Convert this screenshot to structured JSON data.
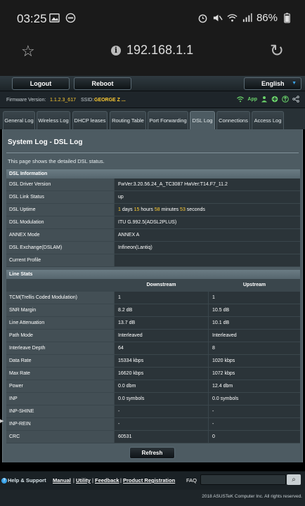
{
  "status_bar": {
    "time": "03:25",
    "battery": "86%"
  },
  "browser": {
    "url": "192.168.1.1"
  },
  "header": {
    "logout_label": "Logout",
    "reboot_label": "Reboot",
    "language": "English",
    "firmware_label": "Firmware Version:",
    "firmware_value": "1.1.2.3_617",
    "ssid_label": "SSID:",
    "ssid_value": "GEORGE Z ...",
    "app_label": "App"
  },
  "tabs": [
    {
      "label": "General Log"
    },
    {
      "label": "Wireless Log"
    },
    {
      "label": "DHCP leases"
    },
    {
      "label": "Routing Table"
    },
    {
      "label": "Port Forwarding"
    },
    {
      "label": "DSL Log"
    },
    {
      "label": "Connections"
    },
    {
      "label": "Access Log"
    }
  ],
  "page": {
    "title": "System Log - DSL Log",
    "description": "This page shows the detailed DSL status."
  },
  "dsl_info": {
    "heading": "DSL Information",
    "rows": [
      {
        "label": "DSL Driver Version",
        "value": "FwVer:3.20.56.24_A_TC3087 HwVer:T14.F7_11.2"
      },
      {
        "label": "DSL Link Status",
        "value": "up"
      },
      {
        "label": "DSL Uptime",
        "days": "1",
        "days_unit": "days",
        "hours": "15",
        "hours_unit": "hours",
        "minutes": "58",
        "minutes_unit": "minutes",
        "seconds": "53",
        "seconds_unit": "seconds"
      },
      {
        "label": "DSL Modulation",
        "value": "ITU G.992.5(ADSL2PLUS)"
      },
      {
        "label": "ANNEX Mode",
        "value": "ANNEX A"
      },
      {
        "label": "DSL Exchange(DSLAM)",
        "value": "Infineon(Lantiq)"
      },
      {
        "label": "Current Profile",
        "value": ""
      }
    ]
  },
  "line_stats": {
    "heading": "Line Stats",
    "col_downstream": "Downstream",
    "col_upstream": "Upstream",
    "rows": [
      {
        "label": "TCM(Trellis Coded Modulation)",
        "down": "1",
        "up": "1"
      },
      {
        "label": "SNR Margin",
        "down": "8.2 dB",
        "up": "10.5 dB"
      },
      {
        "label": "Line Attenuation",
        "down": "13.7 dB",
        "up": "10.1 dB"
      },
      {
        "label": "Path Mode",
        "down": "Interleaved",
        "up": "Interleaved"
      },
      {
        "label": "Interleave Depth",
        "down": "64",
        "up": "8"
      },
      {
        "label": "Data Rate",
        "down": "15334 kbps",
        "up": "1020 kbps"
      },
      {
        "label": "Max Rate",
        "down": "16620 kbps",
        "up": "1072 kbps"
      },
      {
        "label": "Power",
        "down": "0.0 dbm",
        "up": "12.4 dbm"
      },
      {
        "label": "INP",
        "down": "0.0 symbols",
        "up": "0.0 symbols"
      },
      {
        "label": "INP-SHINE",
        "down": "-",
        "up": "-"
      },
      {
        "label": "INP-REIN",
        "down": "-",
        "up": "-"
      },
      {
        "label": "CRC",
        "down": "60531",
        "up": "0"
      }
    ]
  },
  "refresh_label": "Refresh",
  "footer": {
    "help": "Help & Support",
    "manual": "Manual",
    "utility": "Utility",
    "feedback": "Feedback",
    "product_registration": "Product Registration",
    "faq": "FAQ",
    "copyright": "2018 ASUSTeK Computer Inc. All rights reserved."
  }
}
